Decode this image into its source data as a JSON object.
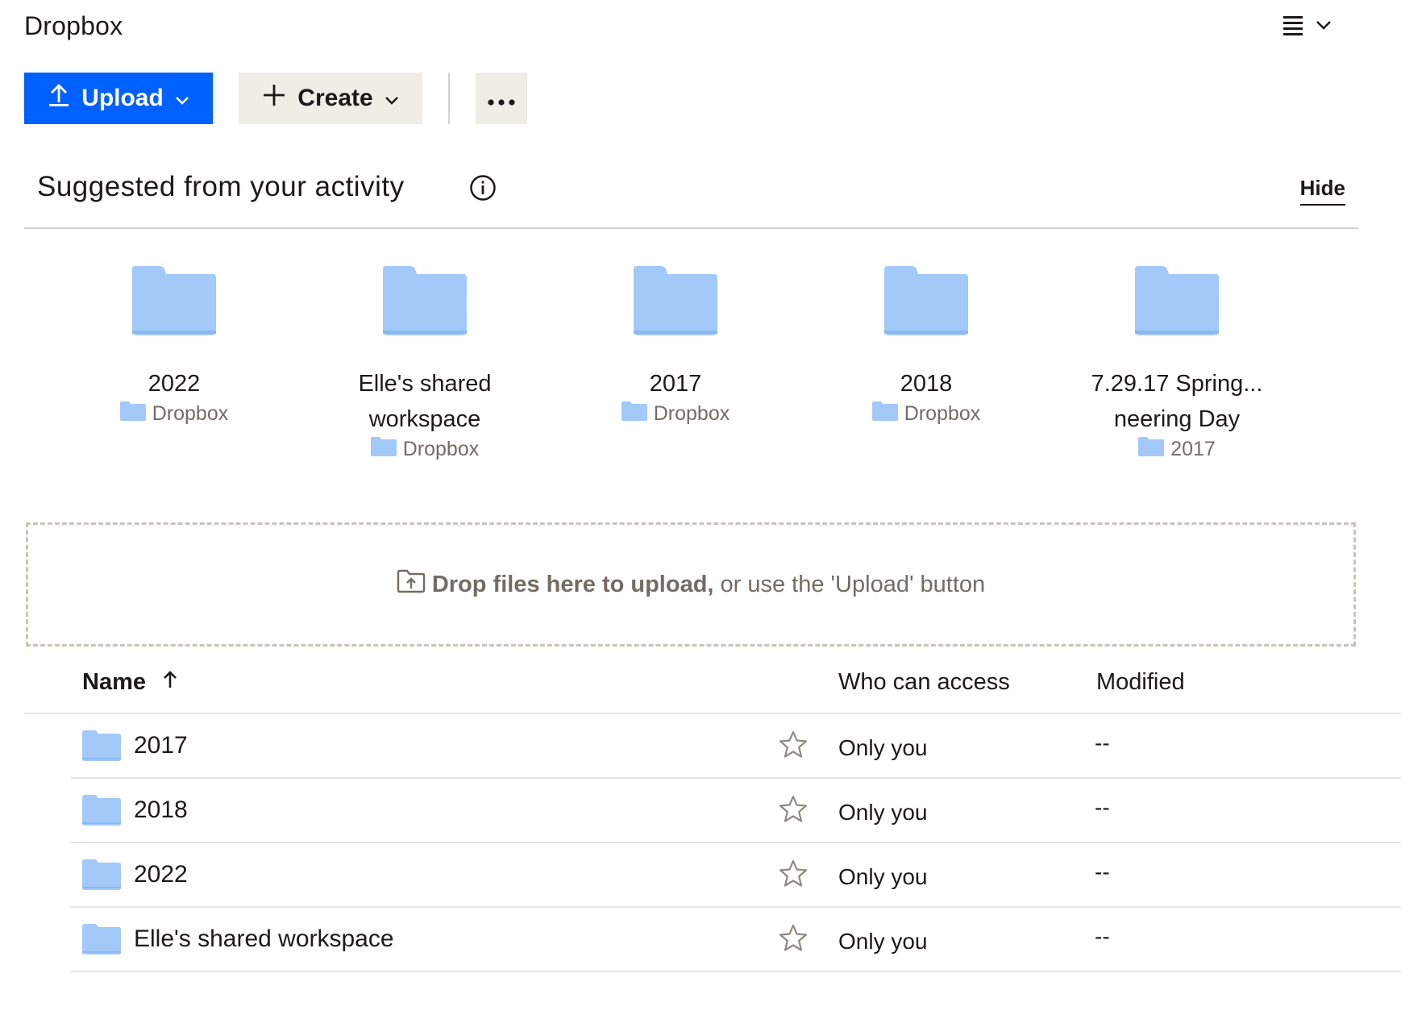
{
  "header": {
    "title": "Dropbox",
    "view_icon": "list-view-icon"
  },
  "toolbar": {
    "upload_label": "Upload",
    "create_label": "Create",
    "more_icon": "ellipsis-icon"
  },
  "suggested": {
    "title": "Suggested from your activity",
    "hide_label": "Hide",
    "items": [
      {
        "name_line1": "2022",
        "name_line2": "",
        "location": "Dropbox"
      },
      {
        "name_line1": "Elle's shared",
        "name_line2": "workspace",
        "location": "Dropbox"
      },
      {
        "name_line1": "2017",
        "name_line2": "",
        "location": "Dropbox"
      },
      {
        "name_line1": "2018",
        "name_line2": "",
        "location": "Dropbox"
      },
      {
        "name_line1": "7.29.17 Spring...",
        "name_line2": "neering Day",
        "location": "2017"
      }
    ]
  },
  "dropzone": {
    "bold_text": "Drop files here to upload,",
    "rest_text": "or use the 'Upload' button"
  },
  "table": {
    "columns": {
      "name": "Name",
      "access": "Who can access",
      "modified": "Modified"
    },
    "rows": [
      {
        "name": "2017",
        "access": "Only you",
        "modified": "--"
      },
      {
        "name": "2018",
        "access": "Only you",
        "modified": "--"
      },
      {
        "name": "2022",
        "access": "Only you",
        "modified": "--"
      },
      {
        "name": "Elle's shared workspace",
        "access": "Only you",
        "modified": "--"
      }
    ]
  },
  "colors": {
    "accent": "#0061fe",
    "folder": "#a3c9f8",
    "folder_dark": "#8ab8f2",
    "secondary_bg": "#f0ece6"
  }
}
